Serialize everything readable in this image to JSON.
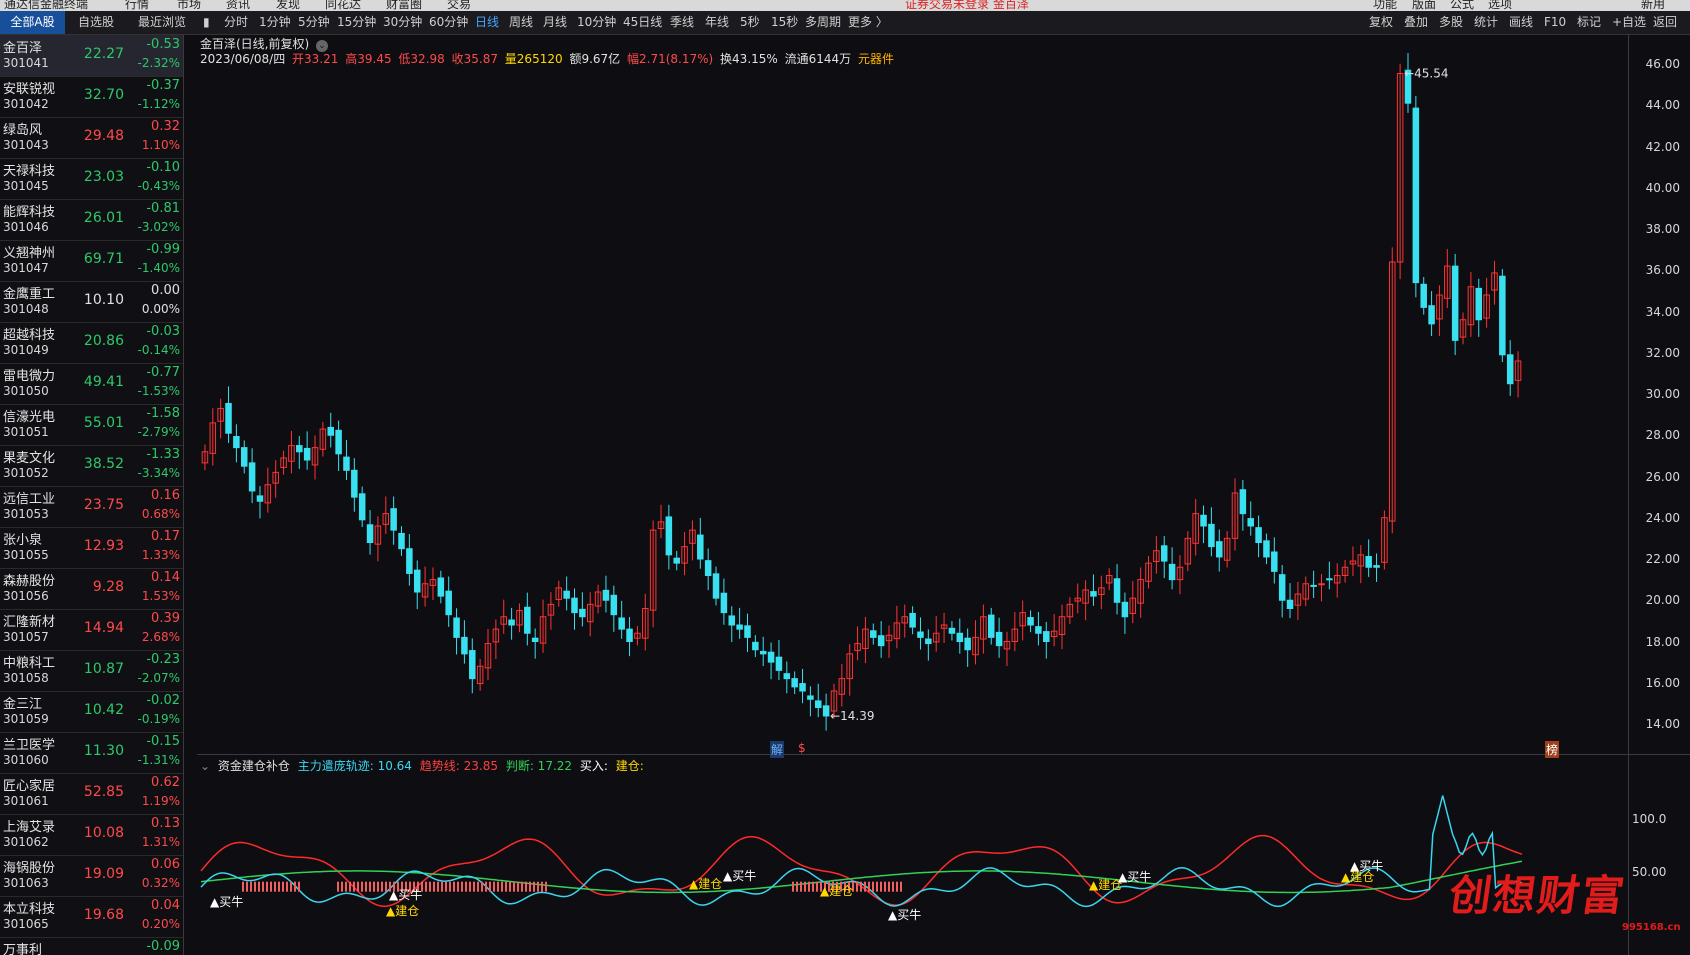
{
  "window": {
    "app_title": "通达信金融终端",
    "menus": [
      "行情",
      "市场",
      "资讯",
      "发现",
      "同花达",
      "财富圈",
      "交易"
    ],
    "notice": "证券交易未登录   金百泽",
    "right_menus": [
      "功能",
      "版面",
      "公式",
      "选项",
      "",
      "",
      "",
      "",
      "",
      "新用"
    ]
  },
  "list_tabs": [
    "全部A股",
    "自选股",
    "最近浏览"
  ],
  "period_tabs": [
    "分时",
    "1分钟",
    "5分钟",
    "15分钟",
    "30分钟",
    "60分钟",
    "日线",
    "周线",
    "月线",
    "10分钟",
    "45日线",
    "季线",
    "年线",
    "5秒",
    "15秒",
    "多周期",
    "更多 〉"
  ],
  "active_period": "日线",
  "toolbar_right": [
    "复权",
    "叠加",
    "多股",
    "统计",
    "画线",
    "F10",
    "标记",
    "+自选",
    "返回"
  ],
  "stocks": [
    {
      "name": "金百泽",
      "code": "301041",
      "price": "22.27",
      "change": "-0.53",
      "pct": "-2.32%",
      "dir": "dn"
    },
    {
      "name": "安联锐视",
      "code": "301042",
      "price": "32.70",
      "change": "-0.37",
      "pct": "-1.12%",
      "dir": "dn"
    },
    {
      "name": "绿岛风",
      "code": "301043",
      "price": "29.48",
      "change": "0.32",
      "pct": "1.10%",
      "dir": "up"
    },
    {
      "name": "天禄科技",
      "code": "301045",
      "price": "23.03",
      "change": "-0.10",
      "pct": "-0.43%",
      "dir": "dn"
    },
    {
      "name": "能辉科技",
      "code": "301046",
      "price": "26.01",
      "change": "-0.81",
      "pct": "-3.02%",
      "dir": "dn"
    },
    {
      "name": "义翘神州",
      "code": "301047",
      "price": "69.71",
      "change": "-0.99",
      "pct": "-1.40%",
      "dir": "dn"
    },
    {
      "name": "金鹰重工",
      "code": "301048",
      "price": "10.10",
      "change": "0.00",
      "pct": "0.00%",
      "dir": "eq"
    },
    {
      "name": "超越科技",
      "code": "301049",
      "price": "20.86",
      "change": "-0.03",
      "pct": "-0.14%",
      "dir": "dn"
    },
    {
      "name": "雷电微力",
      "code": "301050",
      "price": "49.41",
      "change": "-0.77",
      "pct": "-1.53%",
      "dir": "dn"
    },
    {
      "name": "信濠光电",
      "code": "301051",
      "price": "55.01",
      "change": "-1.58",
      "pct": "-2.79%",
      "dir": "dn"
    },
    {
      "name": "果麦文化",
      "code": "301052",
      "price": "38.52",
      "change": "-1.33",
      "pct": "-3.34%",
      "dir": "dn"
    },
    {
      "name": "远信工业",
      "code": "301053",
      "price": "23.75",
      "change": "0.16",
      "pct": "0.68%",
      "dir": "up"
    },
    {
      "name": "张小泉",
      "code": "301055",
      "price": "12.93",
      "change": "0.17",
      "pct": "1.33%",
      "dir": "up"
    },
    {
      "name": "森赫股份",
      "code": "301056",
      "price": "9.28",
      "change": "0.14",
      "pct": "1.53%",
      "dir": "up"
    },
    {
      "name": "汇隆新材",
      "code": "301057",
      "price": "14.94",
      "change": "0.39",
      "pct": "2.68%",
      "dir": "up"
    },
    {
      "name": "中粮科工",
      "code": "301058",
      "price": "10.87",
      "change": "-0.23",
      "pct": "-2.07%",
      "dir": "dn"
    },
    {
      "name": "金三江",
      "code": "301059",
      "price": "10.42",
      "change": "-0.02",
      "pct": "-0.19%",
      "dir": "dn"
    },
    {
      "name": "兰卫医学",
      "code": "301060",
      "price": "11.30",
      "change": "-0.15",
      "pct": "-1.31%",
      "dir": "dn"
    },
    {
      "name": "匠心家居",
      "code": "301061",
      "price": "52.85",
      "change": "0.62",
      "pct": "1.19%",
      "dir": "up"
    },
    {
      "name": "上海艾录",
      "code": "301062",
      "price": "10.08",
      "change": "0.13",
      "pct": "1.31%",
      "dir": "up"
    },
    {
      "name": "海锅股份",
      "code": "301063",
      "price": "19.09",
      "change": "0.06",
      "pct": "0.32%",
      "dir": "up"
    },
    {
      "name": "本立科技",
      "code": "301065",
      "price": "19.68",
      "change": "0.04",
      "pct": "0.20%",
      "dir": "up"
    },
    {
      "name": "万事利",
      "code": "",
      "price": "",
      "change": "-0.09",
      "pct": "",
      "dir": "dn"
    }
  ],
  "chart": {
    "title": "金百泽(日线,前复权)",
    "date": "2023/06/08/四",
    "open": "开33.21",
    "high": "高39.45",
    "low": "低32.98",
    "close": "收35.87",
    "volume": "量265120",
    "amount": "额9.67亿",
    "range": "幅2.71(8.17%)",
    "turnover": "换43.15%",
    "float": "流通6144万",
    "sector": "元器件",
    "annot_high": "45.54",
    "annot_low": "14.39",
    "marker_1": "解",
    "marker_2": "$",
    "marker_3": "榜",
    "price_ticks": [
      "46.00",
      "44.00",
      "42.00",
      "40.00",
      "38.00",
      "36.00",
      "34.00",
      "32.00",
      "30.00",
      "28.00",
      "26.00",
      "24.00",
      "22.00",
      "20.00",
      "18.00",
      "16.00",
      "14.00"
    ],
    "colors": {
      "up": "#ff3333",
      "down": "#39e0f0",
      "background": "#0e0e12"
    }
  },
  "chart_data": [
    {
      "type": "candlestick",
      "title": "金百泽(日线,前复权)",
      "ylim": [
        14.0,
        46.0
      ],
      "annotations": [
        {
          "label": "45.54",
          "y": 45.54
        },
        {
          "label": "14.39",
          "y": 14.39
        }
      ],
      "closes": [
        27.2,
        28.6,
        29.3,
        28.1,
        27.4,
        26.5,
        25.3,
        24.8,
        25.6,
        26.2,
        26.9,
        27.5,
        27.2,
        26.8,
        27.4,
        28.3,
        28.0,
        27.1,
        26.3,
        25.0,
        23.9,
        22.8,
        23.6,
        24.2,
        23.4,
        22.5,
        21.3,
        20.4,
        20.8,
        21.0,
        20.2,
        19.3,
        18.2,
        17.4,
        16.2,
        16.8,
        17.9,
        18.6,
        19.2,
        18.8,
        19.5,
        18.4,
        18.0,
        19.2,
        19.8,
        20.6,
        20.1,
        19.4,
        19.2,
        19.8,
        20.4,
        20.0,
        19.3,
        18.6,
        18.0,
        18.4,
        19.6,
        23.4,
        23.8,
        22.2,
        21.8,
        22.6,
        23.4,
        22.0,
        21.2,
        20.1,
        19.4,
        18.8,
        18.6,
        18.2,
        17.6,
        17.4,
        17.0,
        16.6,
        16.2,
        15.8,
        15.6,
        15.2,
        14.8,
        14.39,
        15.6,
        16.2,
        17.4,
        17.9,
        18.6,
        18.2,
        17.8,
        18.3,
        18.9,
        19.2,
        18.7,
        18.2,
        17.9,
        18.4,
        18.8,
        18.4,
        18.0,
        17.6,
        18.2,
        19.2,
        18.2,
        17.8,
        18.0,
        18.6,
        19.4,
        18.8,
        18.4,
        18.0,
        18.5,
        19.2,
        19.8,
        20.1,
        20.5,
        20.2,
        20.6,
        21.2,
        19.9,
        19.2,
        20.1,
        21.0,
        21.8,
        22.4,
        21.9,
        21.0,
        21.6,
        23.0,
        24.2,
        23.6,
        22.6,
        22.1,
        23.0,
        25.2,
        24.2,
        23.6,
        22.8,
        22.1,
        21.4,
        20.0,
        19.6,
        20.3,
        20.8,
        20.7,
        20.8,
        21.0,
        21.2,
        21.6,
        21.9,
        22.2,
        21.6,
        21.6,
        24.0,
        36.4,
        45.54,
        44.1,
        35.4,
        34.2,
        33.4,
        34.8,
        36.2,
        32.6,
        33.6,
        35.2,
        33.6,
        34.8,
        35.87,
        31.9,
        30.5,
        31.6
      ],
      "ylabel": ""
    },
    {
      "type": "line",
      "title": "资金建仓补仓",
      "ylim": [
        0,
        130
      ],
      "series": [
        {
          "name": "主力遣庞轨迹",
          "value_label": "10.64"
        },
        {
          "name": "趋势线",
          "value_label": "23.85"
        },
        {
          "name": "判断",
          "value_label": "17.22"
        }
      ],
      "y_ticks": [
        "100.0",
        "50.00"
      ],
      "signals": [
        "▲买牛",
        "▲建仓"
      ]
    }
  ],
  "indicator": {
    "name": "资金建仓补仓",
    "l1": "主力遣庞轨迹: 10.64",
    "l2": "趋势线: 23.85",
    "l3": "判断: 17.22",
    "l4": "买入:",
    "l5": "建仓:",
    "sig_buy": "▲买牛",
    "sig_build": "▲建仓",
    "tick_100": "100.0",
    "tick_50": "50.00"
  },
  "watermark": {
    "text": "创想财富",
    "url": "995168.cn"
  }
}
